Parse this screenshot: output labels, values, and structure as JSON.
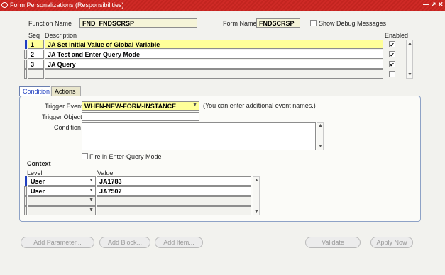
{
  "window": {
    "title": "Form Personalizations (Responsibilities)"
  },
  "header": {
    "function_name_label": "Function Name",
    "function_name_value": "FND_FNDSCRSP",
    "form_name_label": "Form Name",
    "form_name_value": "FNDSCRSP",
    "show_debug_label": "Show Debug Messages"
  },
  "rules": {
    "seq_header": "Seq",
    "description_header": "Description",
    "enabled_header": "Enabled",
    "rows": [
      {
        "seq": "1",
        "description": "JA Set Initial Value of Global Variable",
        "enabled": true
      },
      {
        "seq": "2",
        "description": "JA Test and Enter Query Mode",
        "enabled": true
      },
      {
        "seq": "3",
        "description": "JA Query",
        "enabled": true
      },
      {
        "seq": "",
        "description": "",
        "enabled": false
      }
    ]
  },
  "tabs": [
    {
      "label": "Condition",
      "active": true
    },
    {
      "label": "Actions",
      "active": false
    }
  ],
  "condition": {
    "trigger_event_label": "Trigger Event",
    "trigger_event_value": "WHEN-NEW-FORM-INSTANCE",
    "trigger_event_hint": "(You can enter additional event names.)",
    "trigger_object_label": "Trigger Object",
    "trigger_object_value": "",
    "condition_label": "Condition",
    "condition_value": "",
    "fire_in_query_label": "Fire in Enter-Query Mode"
  },
  "context": {
    "title": "Context",
    "level_header": "Level",
    "value_header": "Value",
    "rows": [
      {
        "level": "User",
        "value": "JA1783"
      },
      {
        "level": "User",
        "value": "JA7507"
      },
      {
        "level": "",
        "value": ""
      },
      {
        "level": "",
        "value": ""
      }
    ]
  },
  "buttons": {
    "add_parameter": "Add Parameter...",
    "add_block": "Add Block...",
    "add_item": "Add Item...",
    "validate": "Validate",
    "apply_now": "Apply Now"
  },
  "colors": {
    "title_bar": "#cf2a26",
    "selected_row": "#ffff99",
    "accent": "#1f3fc0"
  }
}
